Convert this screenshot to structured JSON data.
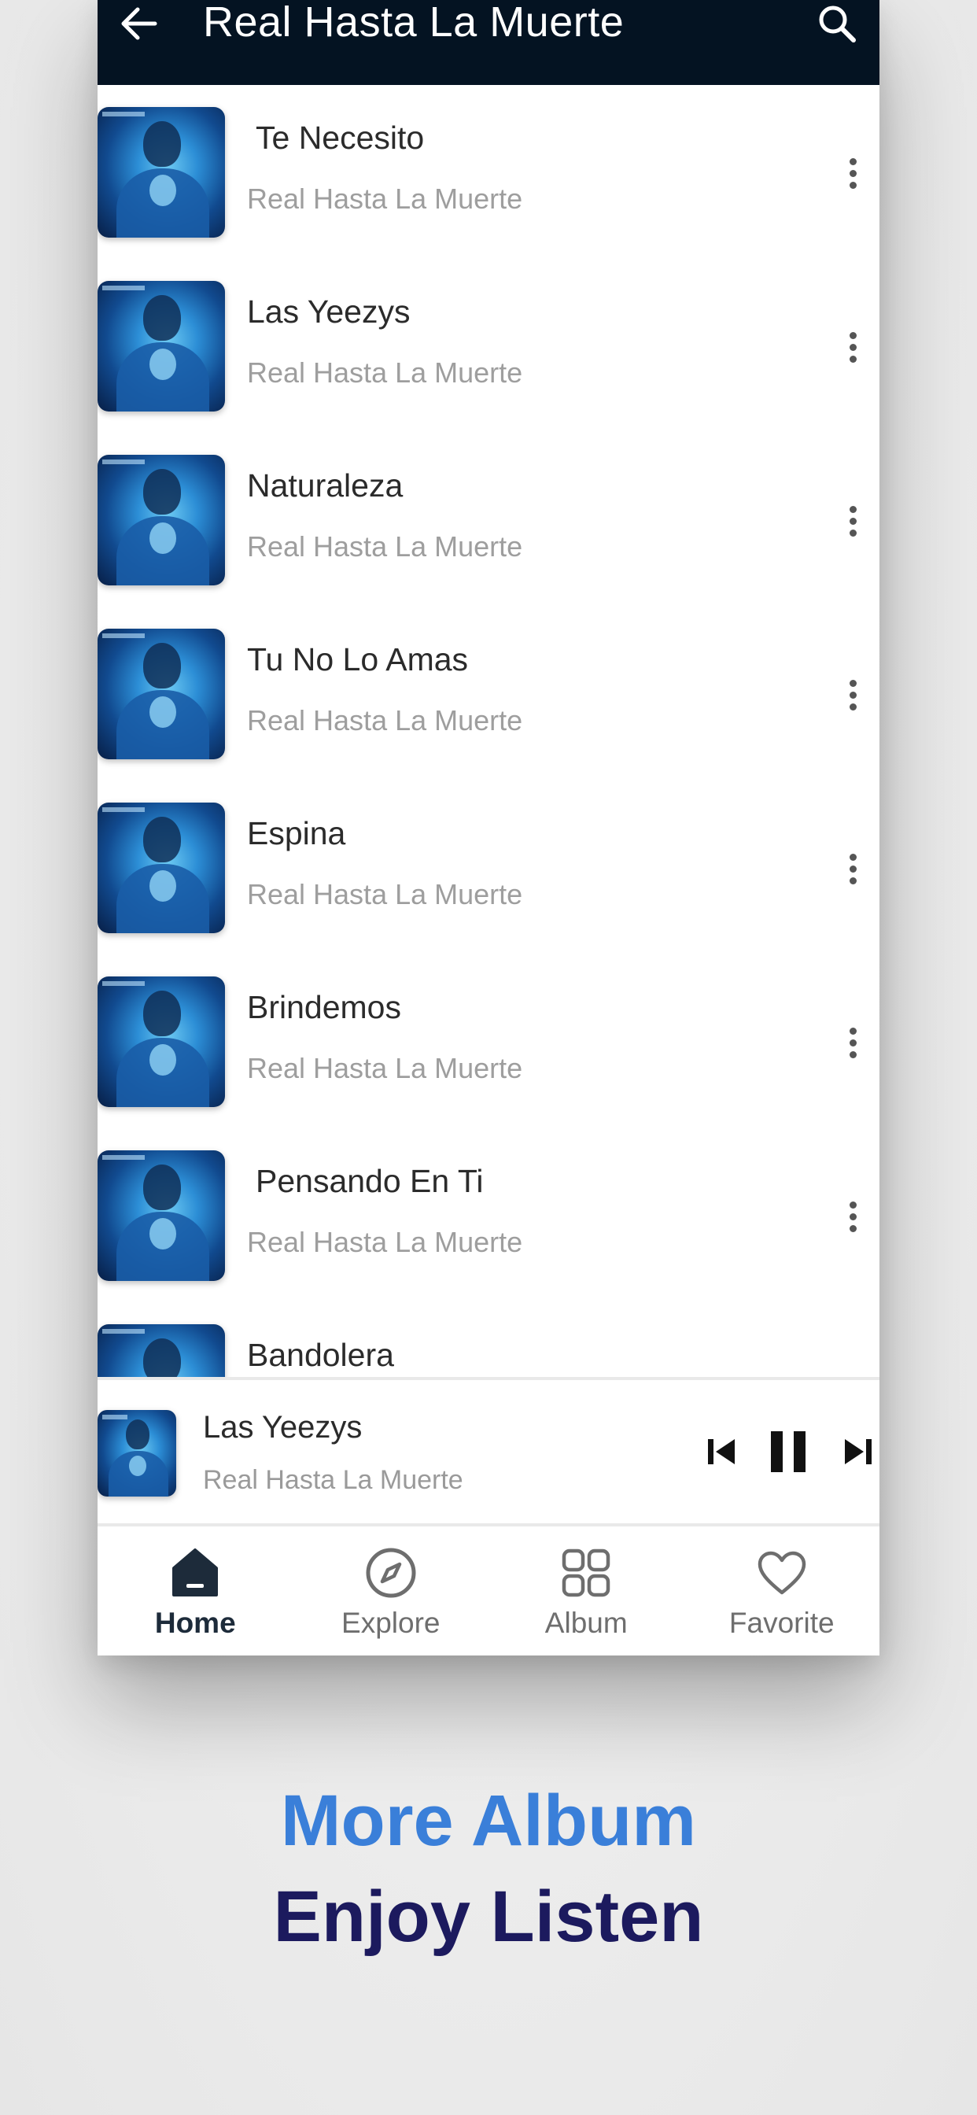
{
  "appbar": {
    "title": "Real Hasta La Muerte",
    "back_icon": "arrow-left-icon",
    "search_icon": "search-icon"
  },
  "songs": [
    {
      "title": "Te Necesito",
      "artist": "Real Hasta La Muerte"
    },
    {
      "title": "Las Yeezys",
      "artist": "Real Hasta La Muerte"
    },
    {
      "title": "Naturaleza",
      "artist": "Real Hasta La Muerte"
    },
    {
      "title": "Tu No Lo Amas",
      "artist": "Real Hasta La Muerte"
    },
    {
      "title": "Espina",
      "artist": "Real Hasta La Muerte"
    },
    {
      "title": "Brindemos",
      "artist": "Real Hasta La Muerte"
    },
    {
      "title": "Pensando En Ti",
      "artist": "Real Hasta La Muerte"
    },
    {
      "title": "Bandolera",
      "artist": ""
    }
  ],
  "now_playing": {
    "title": "Las Yeezys",
    "artist": "Real Hasta La Muerte",
    "state": "playing"
  },
  "nav": {
    "items": [
      {
        "label": "Home",
        "icon": "home-icon",
        "active": true
      },
      {
        "label": "Explore",
        "icon": "compass-icon",
        "active": false
      },
      {
        "label": "Album",
        "icon": "grid-icon",
        "active": false
      },
      {
        "label": "Favorite",
        "icon": "heart-icon",
        "active": false
      }
    ]
  },
  "promo": {
    "line1": "More Album",
    "line2": "Enjoy Listen"
  },
  "colors": {
    "appbar_bg": "#041322",
    "promo_line1": "#3a7fd9",
    "promo_line2": "#1c1a5e",
    "nav_active": "#1d2b3a"
  }
}
